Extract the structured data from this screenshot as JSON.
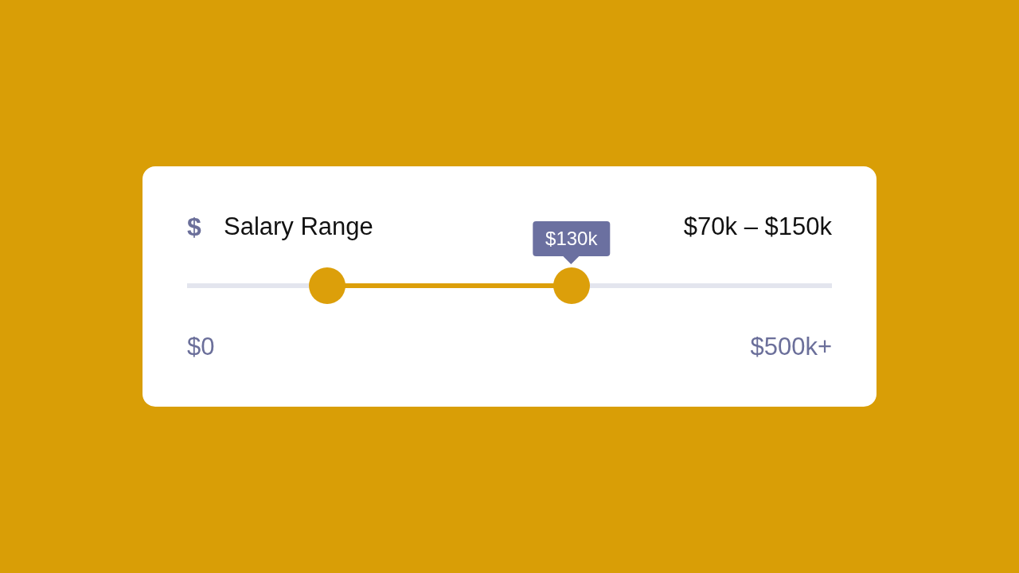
{
  "header": {
    "icon": "$",
    "title": "Salary Range",
    "range_text": "$70k – $150k"
  },
  "slider": {
    "low": {
      "level": 0.217
    },
    "high": {
      "level": 0.596,
      "tooltip": "$130k"
    }
  },
  "scale": {
    "min_label": "$0",
    "max_label": "$500k+"
  }
}
